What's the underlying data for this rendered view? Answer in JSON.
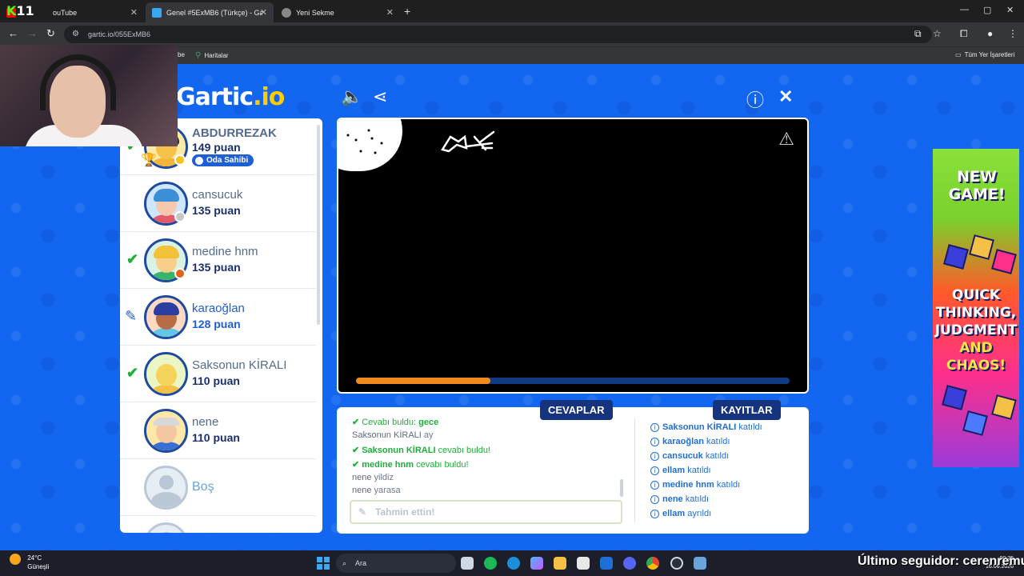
{
  "browser": {
    "tabs": [
      {
        "title": "ouTube",
        "active": false
      },
      {
        "title": "Genel #5ExMB6 (Türkçe) - Gartic",
        "active": true
      },
      {
        "title": "Yeni Sekme",
        "active": false
      }
    ],
    "new_tab": "+",
    "url": "gartic.io/055ExMB6",
    "bookmarks": [
      "be",
      "Haritalar"
    ],
    "all_bookmarks": "Tüm Yer İşaretleri"
  },
  "stream": {
    "logo_k": "K",
    "logo_num": "11",
    "follower_text": "Último seguidor: cerenremu"
  },
  "game": {
    "logo_main": "Gartic",
    "logo_suffix": ".io",
    "players": [
      {
        "name": "ABDURREZAK",
        "score": "149 puan",
        "badge": "Oda Sahibi",
        "status": "owner",
        "skin": "#f4c14a",
        "hair": "#2b2b2b",
        "shirt": "#f4b53a",
        "dot": "#f7c21a"
      },
      {
        "name": "cansucuk",
        "score": "135 puan",
        "status": "none",
        "skin": "#f6c8ae",
        "hair": "#3a8fd6",
        "shirt": "#e35b6a",
        "dot": "#c8c8c8"
      },
      {
        "name": "medine hnm",
        "score": "135 puan",
        "status": "guessed",
        "skin": "#f7cf8a",
        "hair": "#f2c33a",
        "shirt": "#38b56a",
        "dot": "#e0651c"
      },
      {
        "name": "karaoğlan",
        "score": "128 puan",
        "status": "drawing",
        "skin": "#b86c46",
        "hair": "#2a3fa0",
        "shirt": "#62c6e6",
        "dot": null
      },
      {
        "name": "Saksonun KİRALI",
        "score": "110 puan",
        "status": "guessed",
        "skin": "#f6d35a",
        "hair": "#f6d35a",
        "shirt": "#f5c046",
        "dot": null
      },
      {
        "name": "nene",
        "score": "110 puan",
        "status": "none",
        "skin": "#f3c7a2",
        "hair": "#d8d8d8",
        "shirt": "#3a6fd6",
        "dot": null
      }
    ],
    "empty_slot": "Boş",
    "round_progress": 0.31,
    "tabs": {
      "answers": "CEVAPLAR",
      "logs": "KAYITLAR"
    },
    "answers": [
      {
        "type": "ok",
        "prefix": "Cevabı buldu:",
        "text": "gece"
      },
      {
        "type": "plain",
        "name": "Saksonun KİRALI",
        "text": "ay"
      },
      {
        "type": "ok",
        "name": "Saksonun KİRALI",
        "text": "cevabı buldu!"
      },
      {
        "type": "ok",
        "name": "medine hnm",
        "text": "cevabı buldu!"
      },
      {
        "type": "plain",
        "name": "nene",
        "text": "yildiz"
      },
      {
        "type": "plain",
        "name": "nene",
        "text": "yarasa"
      }
    ],
    "guess_placeholder": "Tahmin ettin!",
    "logs": [
      {
        "name": "Saksonun KİRALI",
        "action": "katıldı"
      },
      {
        "name": "karaoğlan",
        "action": "katıldı"
      },
      {
        "name": "cansucuk",
        "action": "katıldı"
      },
      {
        "name": "ellam",
        "action": "katıldı"
      },
      {
        "name": "medine hnm",
        "action": "katıldı"
      },
      {
        "name": "nene",
        "action": "katıldı"
      },
      {
        "name": "ellam",
        "action": "ayrıldı"
      }
    ]
  },
  "ad": {
    "headline_1": "NEW",
    "headline_2": "GAME!",
    "tagline_1": "QUICK",
    "tagline_2": "THINKING,",
    "tagline_3": "JUDGMENT",
    "tagline_4": "AND",
    "tagline_5": "CHAOS!"
  },
  "taskbar": {
    "temp": "24°C",
    "weather": "Güneşli",
    "search": "Ara",
    "time": "00:25",
    "date": "16.06.2026"
  }
}
